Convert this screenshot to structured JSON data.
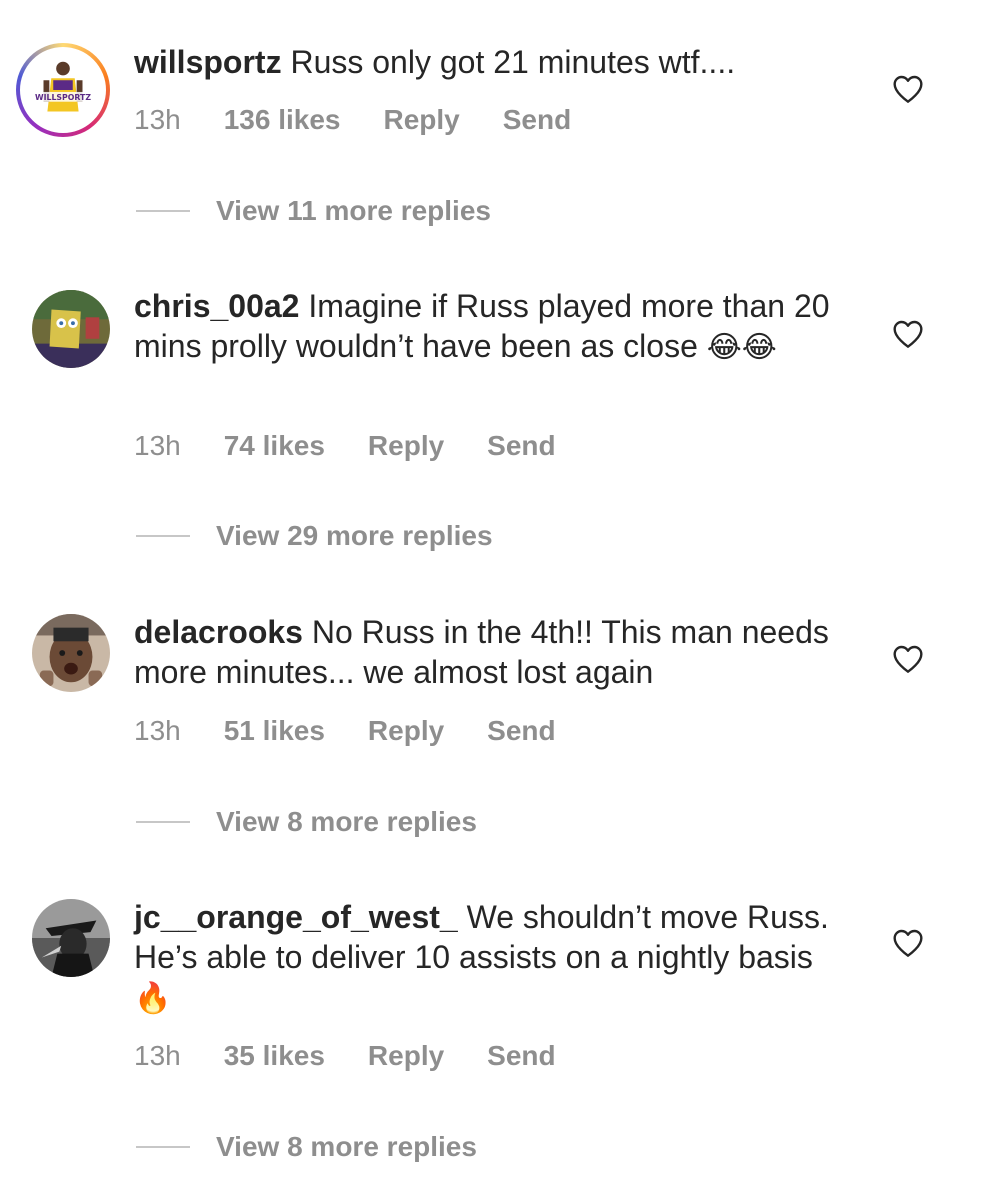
{
  "comments": [
    {
      "username": "willsportz",
      "text": "Russ only got 21 minutes wtf....",
      "emoji": "",
      "time": "13h",
      "likes": "136 likes",
      "reply": "Reply",
      "send": "Send",
      "view_replies": "View 11 more replies",
      "avatar_label": "WILLSPORTZ"
    },
    {
      "username": "chris_00a2",
      "text": "Imagine if Russ played more than 20 mins prolly wouldn’t have been as close",
      "emoji": "😂😂",
      "time": "13h",
      "likes": "74 likes",
      "reply": "Reply",
      "send": "Send",
      "view_replies": "View 29 more replies"
    },
    {
      "username": "delacrooks",
      "text": "No Russ in the 4th!! This man needs more minutes... we almost lost again",
      "emoji": "",
      "time": "13h",
      "likes": "51 likes",
      "reply": "Reply",
      "send": "Send",
      "view_replies": "View 8 more replies"
    },
    {
      "username": "jc__orange_of_west_",
      "text": "We shouldn’t move Russ. He’s able to deliver 10 assists on a nightly basis",
      "emoji": "🔥",
      "time": "13h",
      "likes": "35 likes",
      "reply": "Reply",
      "send": "Send",
      "view_replies": "View 8 more replies"
    }
  ],
  "colors": {
    "text": "#262626",
    "meta": "#8e8e8e",
    "divider": "#c7c7c7"
  }
}
